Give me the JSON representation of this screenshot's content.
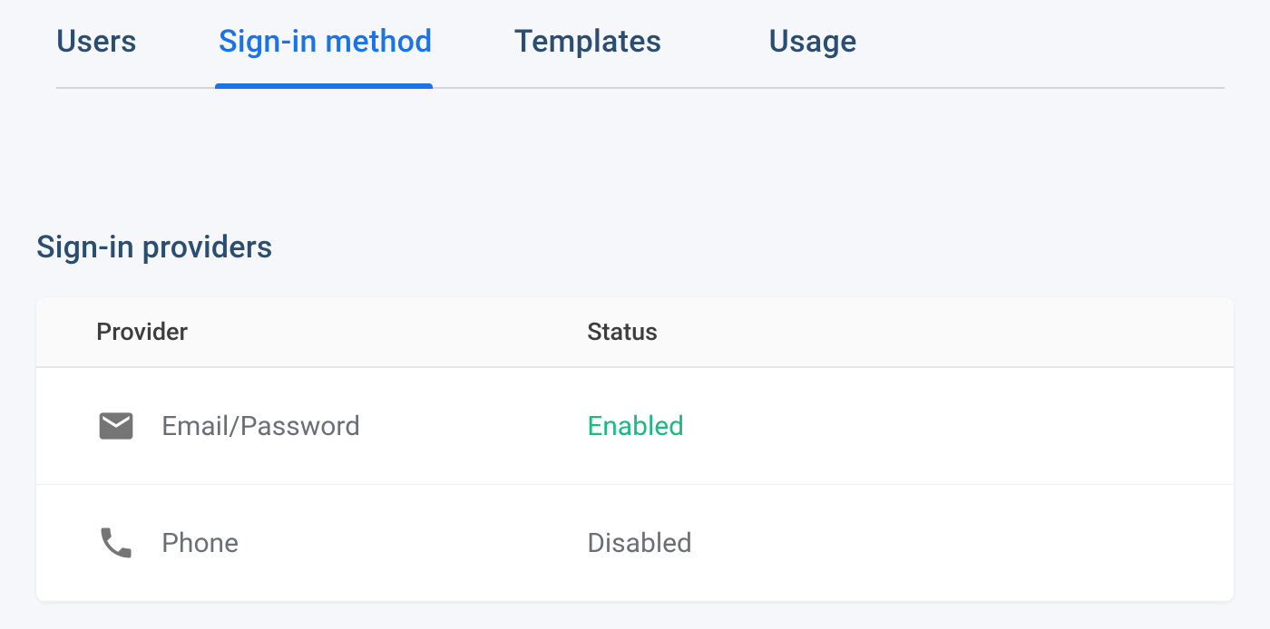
{
  "tabs": [
    {
      "label": "Users",
      "active": false
    },
    {
      "label": "Sign-in method",
      "active": true
    },
    {
      "label": "Templates",
      "active": false
    },
    {
      "label": "Usage",
      "active": false
    }
  ],
  "section": {
    "title": "Sign-in providers"
  },
  "table": {
    "headers": {
      "provider": "Provider",
      "status": "Status"
    },
    "rows": [
      {
        "icon": "email-icon",
        "name": "Email/Password",
        "status": "Enabled",
        "status_class": "enabled"
      },
      {
        "icon": "phone-icon",
        "name": "Phone",
        "status": "Disabled",
        "status_class": "disabled"
      }
    ]
  }
}
